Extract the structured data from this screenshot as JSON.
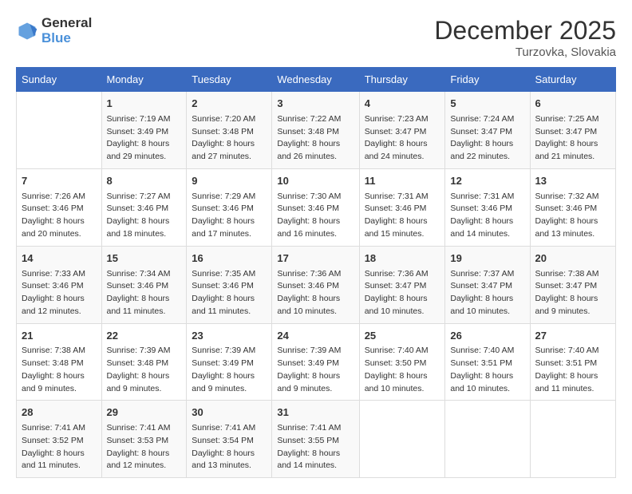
{
  "header": {
    "logo_general": "General",
    "logo_blue": "Blue",
    "month": "December 2025",
    "location": "Turzovka, Slovakia"
  },
  "weekdays": [
    "Sunday",
    "Monday",
    "Tuesday",
    "Wednesday",
    "Thursday",
    "Friday",
    "Saturday"
  ],
  "weeks": [
    [
      {
        "day": "",
        "sunrise": "",
        "sunset": "",
        "daylight": ""
      },
      {
        "day": "1",
        "sunrise": "Sunrise: 7:19 AM",
        "sunset": "Sunset: 3:49 PM",
        "daylight": "Daylight: 8 hours and 29 minutes."
      },
      {
        "day": "2",
        "sunrise": "Sunrise: 7:20 AM",
        "sunset": "Sunset: 3:48 PM",
        "daylight": "Daylight: 8 hours and 27 minutes."
      },
      {
        "day": "3",
        "sunrise": "Sunrise: 7:22 AM",
        "sunset": "Sunset: 3:48 PM",
        "daylight": "Daylight: 8 hours and 26 minutes."
      },
      {
        "day": "4",
        "sunrise": "Sunrise: 7:23 AM",
        "sunset": "Sunset: 3:47 PM",
        "daylight": "Daylight: 8 hours and 24 minutes."
      },
      {
        "day": "5",
        "sunrise": "Sunrise: 7:24 AM",
        "sunset": "Sunset: 3:47 PM",
        "daylight": "Daylight: 8 hours and 22 minutes."
      },
      {
        "day": "6",
        "sunrise": "Sunrise: 7:25 AM",
        "sunset": "Sunset: 3:47 PM",
        "daylight": "Daylight: 8 hours and 21 minutes."
      }
    ],
    [
      {
        "day": "7",
        "sunrise": "Sunrise: 7:26 AM",
        "sunset": "Sunset: 3:46 PM",
        "daylight": "Daylight: 8 hours and 20 minutes."
      },
      {
        "day": "8",
        "sunrise": "Sunrise: 7:27 AM",
        "sunset": "Sunset: 3:46 PM",
        "daylight": "Daylight: 8 hours and 18 minutes."
      },
      {
        "day": "9",
        "sunrise": "Sunrise: 7:29 AM",
        "sunset": "Sunset: 3:46 PM",
        "daylight": "Daylight: 8 hours and 17 minutes."
      },
      {
        "day": "10",
        "sunrise": "Sunrise: 7:30 AM",
        "sunset": "Sunset: 3:46 PM",
        "daylight": "Daylight: 8 hours and 16 minutes."
      },
      {
        "day": "11",
        "sunrise": "Sunrise: 7:31 AM",
        "sunset": "Sunset: 3:46 PM",
        "daylight": "Daylight: 8 hours and 15 minutes."
      },
      {
        "day": "12",
        "sunrise": "Sunrise: 7:31 AM",
        "sunset": "Sunset: 3:46 PM",
        "daylight": "Daylight: 8 hours and 14 minutes."
      },
      {
        "day": "13",
        "sunrise": "Sunrise: 7:32 AM",
        "sunset": "Sunset: 3:46 PM",
        "daylight": "Daylight: 8 hours and 13 minutes."
      }
    ],
    [
      {
        "day": "14",
        "sunrise": "Sunrise: 7:33 AM",
        "sunset": "Sunset: 3:46 PM",
        "daylight": "Daylight: 8 hours and 12 minutes."
      },
      {
        "day": "15",
        "sunrise": "Sunrise: 7:34 AM",
        "sunset": "Sunset: 3:46 PM",
        "daylight": "Daylight: 8 hours and 11 minutes."
      },
      {
        "day": "16",
        "sunrise": "Sunrise: 7:35 AM",
        "sunset": "Sunset: 3:46 PM",
        "daylight": "Daylight: 8 hours and 11 minutes."
      },
      {
        "day": "17",
        "sunrise": "Sunrise: 7:36 AM",
        "sunset": "Sunset: 3:46 PM",
        "daylight": "Daylight: 8 hours and 10 minutes."
      },
      {
        "day": "18",
        "sunrise": "Sunrise: 7:36 AM",
        "sunset": "Sunset: 3:47 PM",
        "daylight": "Daylight: 8 hours and 10 minutes."
      },
      {
        "day": "19",
        "sunrise": "Sunrise: 7:37 AM",
        "sunset": "Sunset: 3:47 PM",
        "daylight": "Daylight: 8 hours and 10 minutes."
      },
      {
        "day": "20",
        "sunrise": "Sunrise: 7:38 AM",
        "sunset": "Sunset: 3:47 PM",
        "daylight": "Daylight: 8 hours and 9 minutes."
      }
    ],
    [
      {
        "day": "21",
        "sunrise": "Sunrise: 7:38 AM",
        "sunset": "Sunset: 3:48 PM",
        "daylight": "Daylight: 8 hours and 9 minutes."
      },
      {
        "day": "22",
        "sunrise": "Sunrise: 7:39 AM",
        "sunset": "Sunset: 3:48 PM",
        "daylight": "Daylight: 8 hours and 9 minutes."
      },
      {
        "day": "23",
        "sunrise": "Sunrise: 7:39 AM",
        "sunset": "Sunset: 3:49 PM",
        "daylight": "Daylight: 8 hours and 9 minutes."
      },
      {
        "day": "24",
        "sunrise": "Sunrise: 7:39 AM",
        "sunset": "Sunset: 3:49 PM",
        "daylight": "Daylight: 8 hours and 9 minutes."
      },
      {
        "day": "25",
        "sunrise": "Sunrise: 7:40 AM",
        "sunset": "Sunset: 3:50 PM",
        "daylight": "Daylight: 8 hours and 10 minutes."
      },
      {
        "day": "26",
        "sunrise": "Sunrise: 7:40 AM",
        "sunset": "Sunset: 3:51 PM",
        "daylight": "Daylight: 8 hours and 10 minutes."
      },
      {
        "day": "27",
        "sunrise": "Sunrise: 7:40 AM",
        "sunset": "Sunset: 3:51 PM",
        "daylight": "Daylight: 8 hours and 11 minutes."
      }
    ],
    [
      {
        "day": "28",
        "sunrise": "Sunrise: 7:41 AM",
        "sunset": "Sunset: 3:52 PM",
        "daylight": "Daylight: 8 hours and 11 minutes."
      },
      {
        "day": "29",
        "sunrise": "Sunrise: 7:41 AM",
        "sunset": "Sunset: 3:53 PM",
        "daylight": "Daylight: 8 hours and 12 minutes."
      },
      {
        "day": "30",
        "sunrise": "Sunrise: 7:41 AM",
        "sunset": "Sunset: 3:54 PM",
        "daylight": "Daylight: 8 hours and 13 minutes."
      },
      {
        "day": "31",
        "sunrise": "Sunrise: 7:41 AM",
        "sunset": "Sunset: 3:55 PM",
        "daylight": "Daylight: 8 hours and 14 minutes."
      },
      {
        "day": "",
        "sunrise": "",
        "sunset": "",
        "daylight": ""
      },
      {
        "day": "",
        "sunrise": "",
        "sunset": "",
        "daylight": ""
      },
      {
        "day": "",
        "sunrise": "",
        "sunset": "",
        "daylight": ""
      }
    ]
  ]
}
